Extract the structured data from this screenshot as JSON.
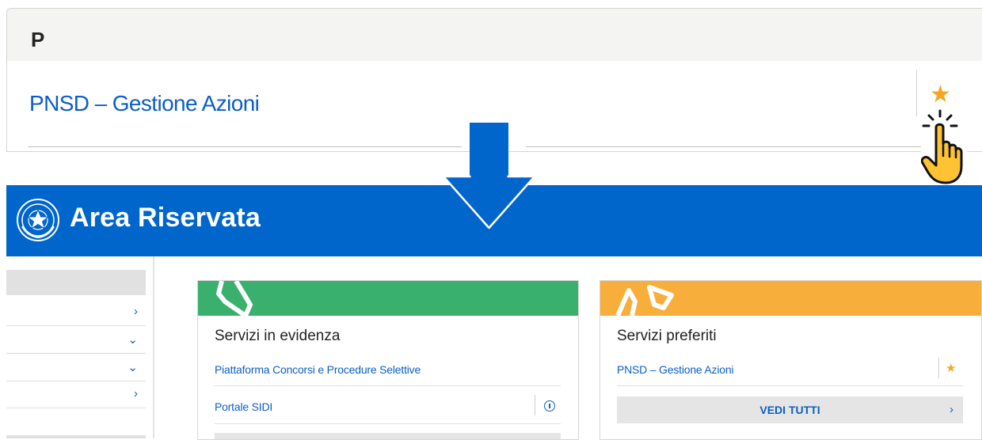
{
  "zoom": {
    "letter": "P",
    "link": "PNSD – Gestione Azioni",
    "star_icon": "star-icon",
    "pointer_icon": "hand-pointer-icon"
  },
  "header": {
    "title": "Area Riservata",
    "emblem_icon": "italian-republic-emblem-icon",
    "background": "#0066cc"
  },
  "transition_icon": "arrow-down-icon",
  "sidebar": {
    "items": [
      {
        "chevron": "›"
      },
      {
        "chevron": "⌄"
      },
      {
        "chevron": "⌄"
      },
      {
        "chevron": "›"
      }
    ]
  },
  "cards": {
    "highlighted": {
      "title": "Servizi in evidenza",
      "band_color": "#3ab06e",
      "band_icon": "megaphone-icon",
      "links": [
        "Piattaforma Concorsi e Procedure Selettive",
        "Portale SIDI"
      ]
    },
    "favorites": {
      "title": "Servizi preferiti",
      "band_color": "#f7ae3b",
      "band_icon": "thumbs-up-icon",
      "links": [
        "PNSD – Gestione Azioni"
      ],
      "button": "VEDI TUTTI",
      "button_chevron": "›"
    }
  }
}
